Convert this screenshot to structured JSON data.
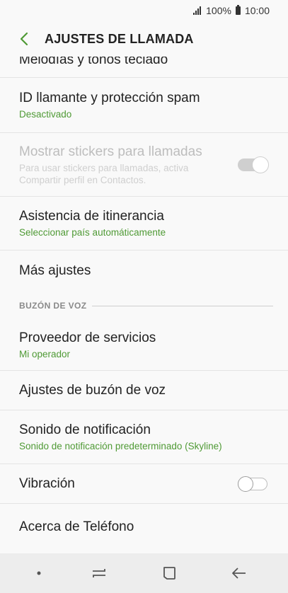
{
  "status": {
    "battery_text": "100%",
    "time": "10:00"
  },
  "app_bar": {
    "title": "AJUSTES DE LLAMADA"
  },
  "items": [
    {
      "title": "Melodías y tonos teclado"
    },
    {
      "title": "ID llamante y protección spam",
      "subtitle": "Desactivado"
    },
    {
      "title": "Mostrar stickers para llamadas",
      "subtitle": "Para usar stickers para llamadas, activa Compartir perfil en Contactos.",
      "toggle": "on",
      "enabled": false
    },
    {
      "title": "Asistencia de itinerancia",
      "subtitle": "Seleccionar país automáticamente"
    },
    {
      "title": "Más ajustes"
    }
  ],
  "voicemail_section": {
    "header": "BUZÓN DE VOZ",
    "items": [
      {
        "title": "Proveedor de servicios",
        "subtitle": "Mi operador"
      },
      {
        "title": "Ajustes de buzón de voz"
      },
      {
        "title": "Sonido de notificación",
        "subtitle": "Sonido de notificación predeterminado (Skyline)"
      },
      {
        "title": "Vibración",
        "toggle": "off"
      },
      {
        "title": "Acerca de Teléfono"
      }
    ]
  },
  "colors": {
    "accent": "#4f9a35",
    "background": "#f9f9f9",
    "nav_bar": "#ededed"
  },
  "icons": {
    "back": "back-arrow-icon",
    "recents": "recents-icon",
    "home": "home-icon",
    "nav_back": "nav-back-icon"
  }
}
